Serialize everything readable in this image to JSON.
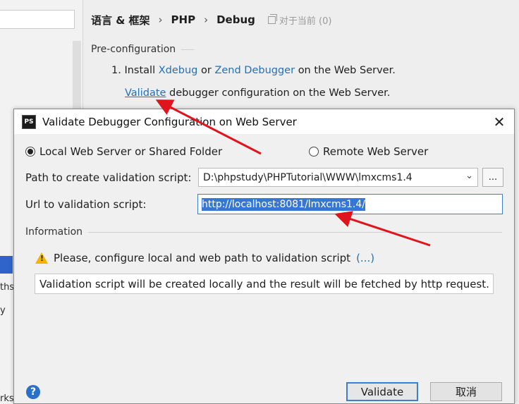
{
  "settings": {
    "breadcrumb": [
      "语言 & 框架",
      "PHP",
      "Debug"
    ],
    "breadcrumb_separator": "›",
    "for_current_project": "对于当前 (0)",
    "left_fragments": [
      "ths",
      "y",
      "rks"
    ],
    "preconfig_title": "Pre-configuration",
    "install": {
      "prefix": "1. Install",
      "xdebug_link": "Xdebug",
      "or": "or",
      "zend_link": "Zend Debugger",
      "suffix": "on the Web Server."
    },
    "validate": {
      "link": "Validate",
      "suffix": "debugger configuration on the Web Server."
    }
  },
  "dialog": {
    "icon_text": "PS",
    "title": "Validate Debugger Configuration on Web Server",
    "close_glyph": "✕",
    "radio_local": "Local Web Server or Shared Folder",
    "radio_remote": "Remote Web Server",
    "selected_mode": "local",
    "path_label": "Path to create validation script:",
    "path_value": "D:\\phpstudy\\PHPTutorial\\WWW\\lmxcms1.4",
    "browse_label": "...",
    "url_label": "Url to validation script:",
    "url_value": "http://localhost:8081/lmxcms1.4/",
    "information_title": "Information",
    "warning_text": "Please, configure local and web path to validation script",
    "warning_link": "(...)",
    "info_text": "Validation script will be created locally and the result will be fetched by http request.",
    "help_label": "?",
    "validate_button": "Validate",
    "cancel_button": "取消"
  },
  "colors": {
    "link": "#2470b3",
    "selection": "#3477d4",
    "arrow": "#e0141c"
  }
}
